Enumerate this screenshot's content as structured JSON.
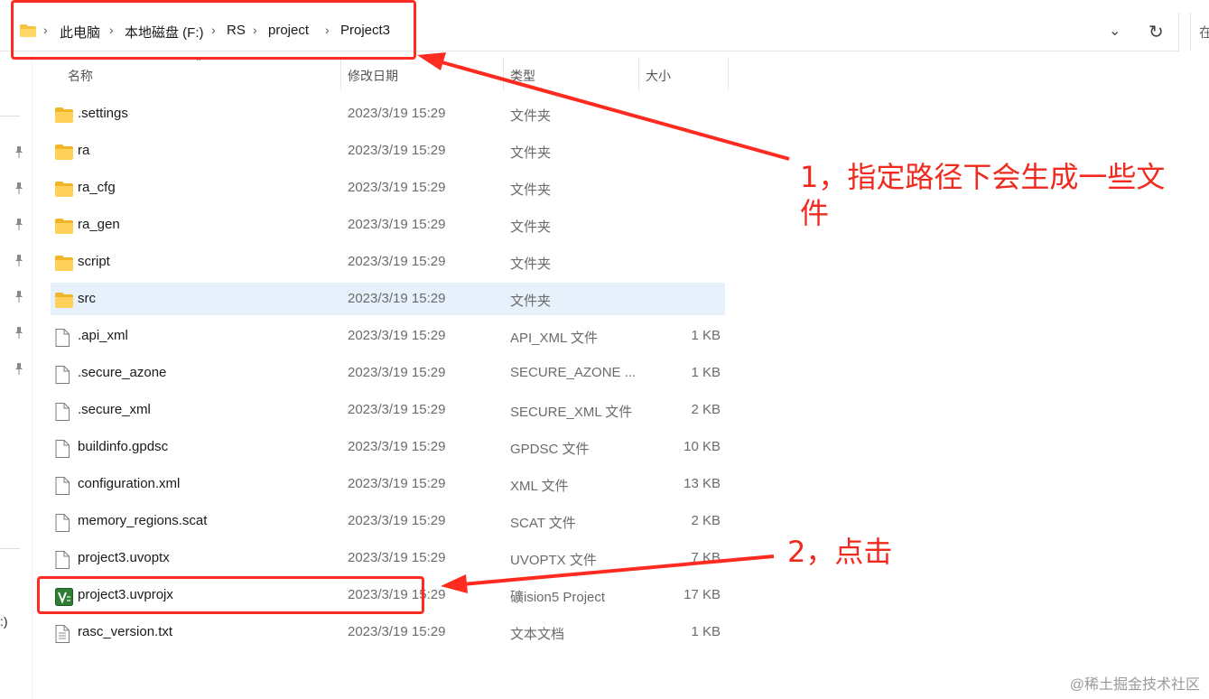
{
  "address": {
    "crumbs": [
      "此电脑",
      "本地磁盘 (F:)",
      "RS",
      "project",
      "Project3"
    ],
    "separator": "›",
    "search_fragment": "在"
  },
  "nav": {
    "drive_fragment": ":)"
  },
  "columns": {
    "name": "名称",
    "modified": "修改日期",
    "type": "类型",
    "size": "大小"
  },
  "files": [
    {
      "name": ".settings",
      "date": "2023/3/19 15:29",
      "type": "文件夹",
      "size": "",
      "icon": "folder-icon"
    },
    {
      "name": "ra",
      "date": "2023/3/19 15:29",
      "type": "文件夹",
      "size": "",
      "icon": "folder-icon"
    },
    {
      "name": "ra_cfg",
      "date": "2023/3/19 15:29",
      "type": "文件夹",
      "size": "",
      "icon": "folder-icon"
    },
    {
      "name": "ra_gen",
      "date": "2023/3/19 15:29",
      "type": "文件夹",
      "size": "",
      "icon": "folder-icon"
    },
    {
      "name": "script",
      "date": "2023/3/19 15:29",
      "type": "文件夹",
      "size": "",
      "icon": "folder-icon"
    },
    {
      "name": "src",
      "date": "2023/3/19 15:29",
      "type": "文件夹",
      "size": "",
      "icon": "folder-icon",
      "selected": true
    },
    {
      "name": ".api_xml",
      "date": "2023/3/19 15:29",
      "type": "API_XML 文件",
      "size": "1 KB",
      "icon": "file-icon"
    },
    {
      "name": ".secure_azone",
      "date": "2023/3/19 15:29",
      "type": "SECURE_AZONE ...",
      "size": "1 KB",
      "icon": "file-icon"
    },
    {
      "name": ".secure_xml",
      "date": "2023/3/19 15:29",
      "type": "SECURE_XML 文件",
      "size": "2 KB",
      "icon": "file-icon"
    },
    {
      "name": "buildinfo.gpdsc",
      "date": "2023/3/19 15:29",
      "type": "GPDSC 文件",
      "size": "10 KB",
      "icon": "file-icon"
    },
    {
      "name": "configuration.xml",
      "date": "2023/3/19 15:29",
      "type": "XML 文件",
      "size": "13 KB",
      "icon": "file-icon"
    },
    {
      "name": "memory_regions.scat",
      "date": "2023/3/19 15:29",
      "type": "SCAT 文件",
      "size": "2 KB",
      "icon": "file-icon"
    },
    {
      "name": "project3.uvoptx",
      "date": "2023/3/19 15:29",
      "type": "UVOPTX 文件",
      "size": "7 KB",
      "icon": "file-icon"
    },
    {
      "name": "project3.uvprojx",
      "date": "2023/3/19 15:29",
      "type": "礦ision5 Project",
      "size": "17 KB",
      "icon": "uvision-project-icon"
    },
    {
      "name": "rasc_version.txt",
      "date": "2023/3/19 15:29",
      "type": "文本文档",
      "size": "1 KB",
      "icon": "text-file-icon"
    }
  ],
  "annotations": {
    "note1_line1": "1，指定路径下会生成一些文",
    "note1_line2": "件",
    "note2": "2，点击",
    "color": "#ff2a20"
  },
  "watermark": "@稀土掘金技术社区"
}
